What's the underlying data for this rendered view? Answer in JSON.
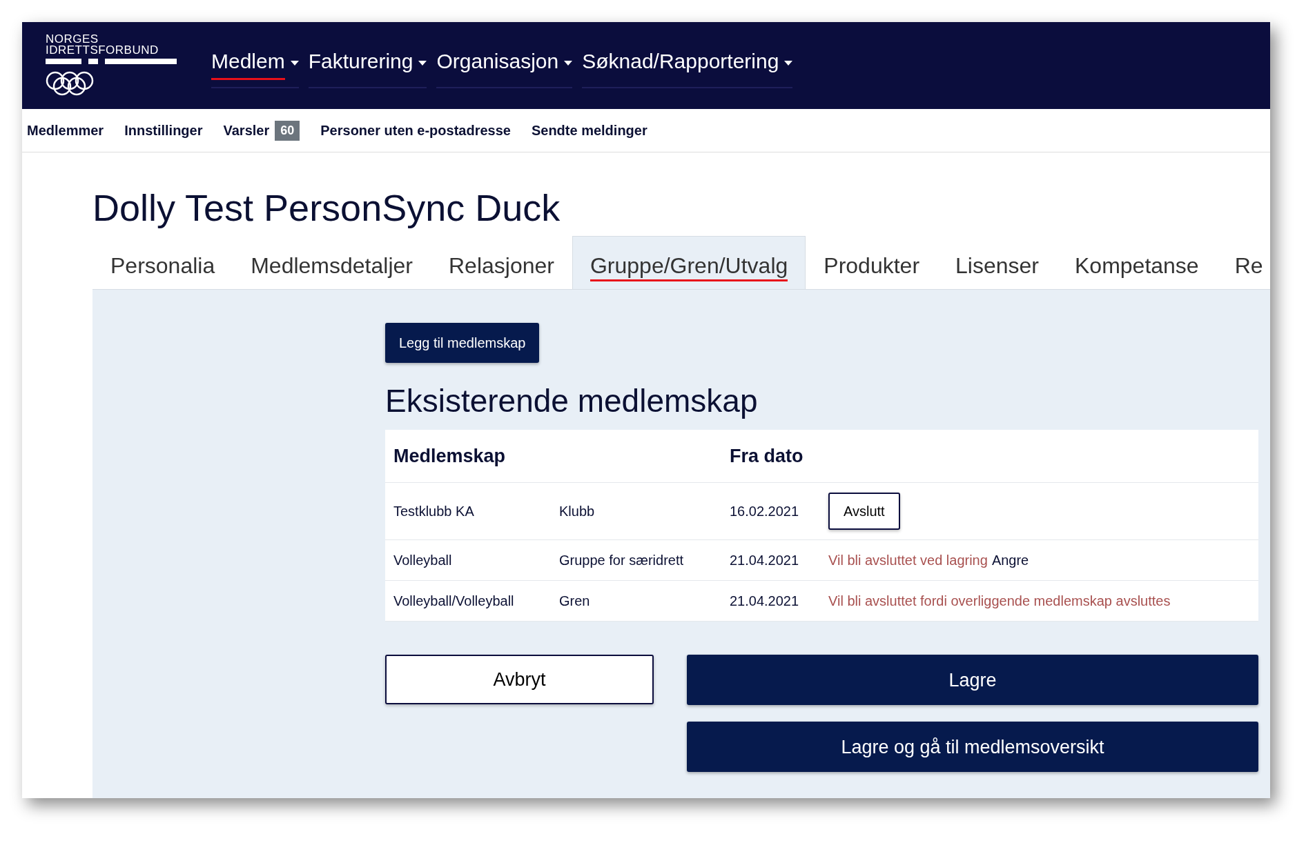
{
  "brand": {
    "line_1": "NORGES",
    "line_2": "IDRETTSFORBUND"
  },
  "main_nav": [
    {
      "label": "Medlem",
      "selected": true
    },
    {
      "label": "Fakturering",
      "selected": false
    },
    {
      "label": "Organisasjon",
      "selected": false
    },
    {
      "label": "Søknad/Rapportering",
      "selected": false
    }
  ],
  "sub_nav": [
    {
      "label": "Medlemmer"
    },
    {
      "label": "Innstillinger"
    },
    {
      "label": "Varsler",
      "badge": "60"
    },
    {
      "label": "Personer uten e-postadresse"
    },
    {
      "label": "Sendte meldinger"
    }
  ],
  "page_title": "Dolly Test PersonSync Duck",
  "tabs": [
    {
      "label": "Personalia",
      "selected": false
    },
    {
      "label": "Medlemsdetaljer",
      "selected": false
    },
    {
      "label": "Relasjoner",
      "selected": false
    },
    {
      "label": "Gruppe/Gren/Utvalg",
      "selected": true
    },
    {
      "label": "Produkter",
      "selected": false
    },
    {
      "label": "Lisenser",
      "selected": false
    },
    {
      "label": "Kompetanse",
      "selected": false
    },
    {
      "label": "Re",
      "selected": false
    }
  ],
  "add_button": "Legg til medlemskap",
  "section_title": "Eksisterende medlemskap",
  "table": {
    "columns": [
      "Medlemskap",
      "Fra dato"
    ],
    "rows": [
      {
        "name": "Testklubb KA",
        "type": "Klubb",
        "from_date": "16.02.2021",
        "kind": "active",
        "action": "Avslutt"
      },
      {
        "name": "Volleyball",
        "type": "Gruppe for særidrett",
        "from_date": "21.04.2021",
        "kind": "pending",
        "status": "Vil bli avsluttet ved lagring",
        "action": "Angre"
      },
      {
        "name": "Volleyball/Volleyball",
        "type": "Gren",
        "from_date": "21.04.2021",
        "kind": "cascade",
        "status": "Vil bli avsluttet fordi overliggende medlemskap avsluttes"
      }
    ]
  },
  "buttons": {
    "cancel": "Avbryt",
    "save": "Lagre",
    "save_and_go": "Lagre og gå til medlemsoversikt"
  }
}
